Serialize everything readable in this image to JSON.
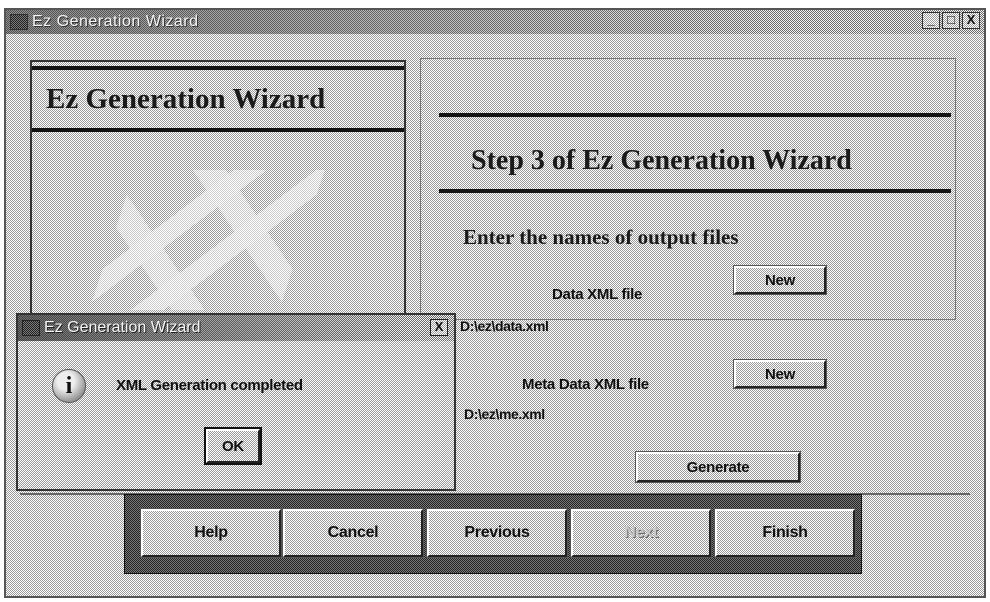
{
  "window": {
    "title": "Ez Generation Wizard",
    "controls": {
      "minimize": "_",
      "maximize": "□",
      "close": "X"
    }
  },
  "left_panel": {
    "heading": "Ez Generation Wizard",
    "logo_icon": "wizard-logo-icon"
  },
  "right_panel": {
    "step_title": "Step 3 of Ez Generation Wizard",
    "instruction": "Enter the names of output files",
    "data_xml": {
      "label": "Data XML file",
      "button": "New",
      "path": "D:\\ez\\data.xml"
    },
    "meta_xml": {
      "label": "Meta Data XML file",
      "button": "New",
      "path": "D:\\ez\\me.xml"
    },
    "generate_button": "Generate"
  },
  "buttons": [
    {
      "label": "Help",
      "enabled": true
    },
    {
      "label": "Cancel",
      "enabled": true
    },
    {
      "label": "Previous",
      "enabled": true
    },
    {
      "label": "Next",
      "enabled": false
    },
    {
      "label": "Finish",
      "enabled": true
    }
  ],
  "dialog": {
    "title": "Ez Generation Wizard",
    "close": "X",
    "icon": "info-icon",
    "icon_glyph": "i",
    "message": "XML Generation completed",
    "ok_button": "OK"
  }
}
